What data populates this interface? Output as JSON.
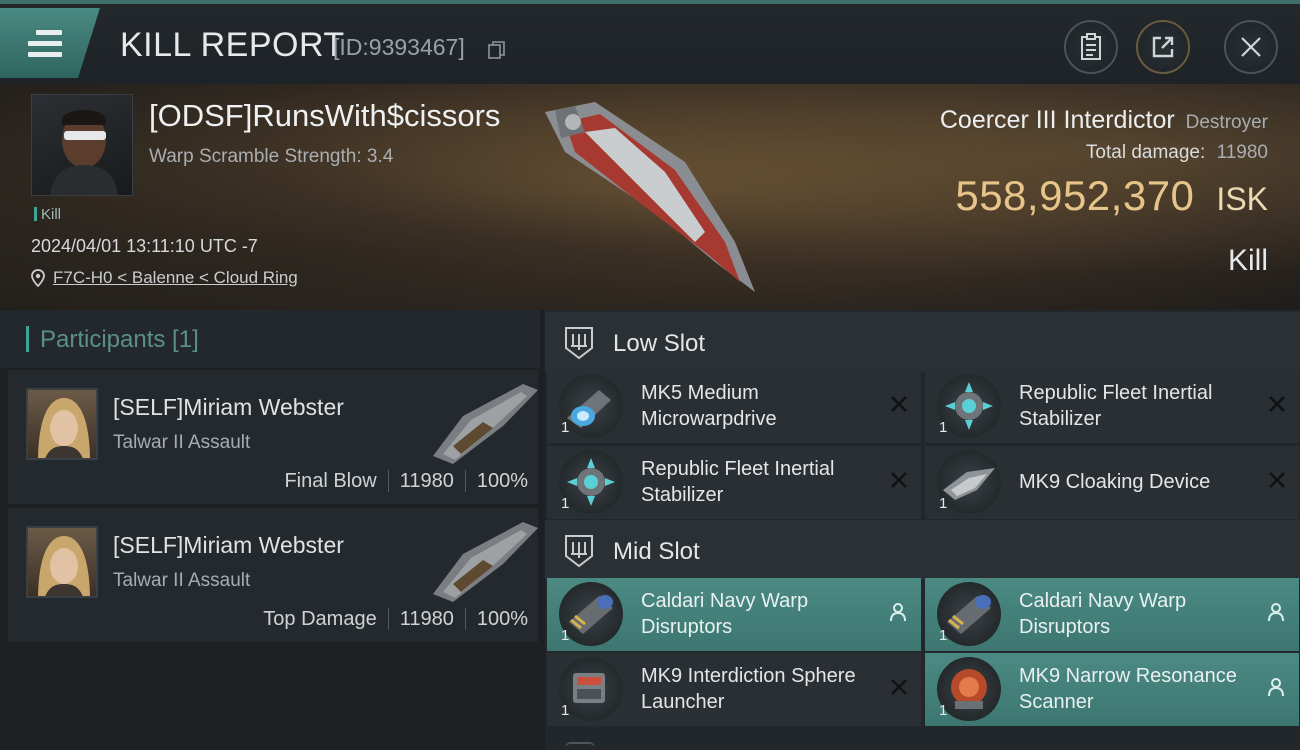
{
  "header": {
    "title": "KILL REPORT",
    "report_id": "[ID:9393467]",
    "icons": [
      "menu-icon",
      "copy-icon",
      "clipboard-icon",
      "share-icon",
      "close-icon"
    ]
  },
  "victim": {
    "name": "[ODSF]RunsWith$cissors",
    "scram_strength": "Warp Scramble Strength: 3.4",
    "kill_tag": "Kill",
    "timestamp": "2024/04/01 13:11:10 UTC -7",
    "location": "F7C-H0 < Balenne < Cloud Ring",
    "ship": "Coercer III Interdictor",
    "ship_class": "Destroyer",
    "damage_label": "Total damage:",
    "damage_value": "11980",
    "isk_amount": "558,952,370",
    "isk_unit": "ISK",
    "result": "Kill"
  },
  "participants": {
    "header": "Participants [1]",
    "list": [
      {
        "name": "[SELF]Miriam Webster",
        "ship": "Talwar II Assault",
        "role": "Final Blow",
        "damage": "11980",
        "percent": "100%"
      },
      {
        "name": "[SELF]Miriam Webster",
        "ship": "Talwar II Assault",
        "role": "Top Damage",
        "damage": "11980",
        "percent": "100%"
      }
    ]
  },
  "fitting": {
    "low_slot": {
      "label": "Low Slot",
      "modules": [
        {
          "name": "MK5 Medium Microwarpdrive",
          "qty": "1",
          "status": "destroyed"
        },
        {
          "name": "Republic Fleet Inertial Stabilizer",
          "qty": "1",
          "status": "destroyed"
        },
        {
          "name": "Republic Fleet Inertial Stabilizer",
          "qty": "1",
          "status": "destroyed"
        },
        {
          "name": "MK9 Cloaking Device",
          "qty": "1",
          "status": "destroyed"
        }
      ]
    },
    "mid_slot": {
      "label": "Mid Slot",
      "modules": [
        {
          "name": "Caldari Navy Warp Disruptors",
          "qty": "1",
          "status": "dropped"
        },
        {
          "name": "Caldari Navy Warp Disruptors",
          "qty": "1",
          "status": "dropped"
        },
        {
          "name": "MK9 Interdiction Sphere Launcher",
          "qty": "1",
          "status": "destroyed"
        },
        {
          "name": "MK9 Narrow Resonance Scanner",
          "qty": "1",
          "status": "dropped"
        }
      ]
    }
  },
  "colors": {
    "accent": "#3fa79a",
    "isk": "#e7c58a",
    "dropped_bg": "#4b8a83"
  }
}
